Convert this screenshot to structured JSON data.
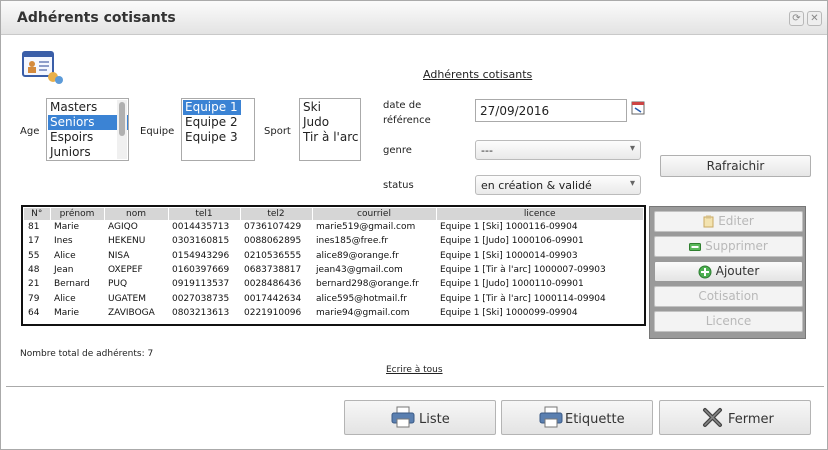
{
  "window": {
    "title": "Adhérents cotisants",
    "controls": [
      "⟳",
      "✕"
    ]
  },
  "page_link_title": "Adhérents cotisants",
  "filters": {
    "age": {
      "label": "Age",
      "options": [
        "Masters",
        "Seniors",
        "Espoirs",
        "Juniors"
      ],
      "selected": "Seniors"
    },
    "equipe": {
      "label": "Equipe",
      "options": [
        "Equipe 1",
        "Equipe 2",
        "Equipe 3"
      ],
      "selected": "Equipe 1"
    },
    "sport": {
      "label": "Sport",
      "options": [
        "Ski",
        "Judo",
        "Tir à l'arc"
      ],
      "selected": ""
    },
    "date_label_line1": "date de",
    "date_label_line2": "référence",
    "date_value": "27/09/2016",
    "genre": {
      "label": "genre",
      "value": "---"
    },
    "status": {
      "label": "status",
      "value": "en création & validé"
    },
    "refresh_label": "Rafraichir"
  },
  "table": {
    "headers": [
      "N°",
      "prénom",
      "nom",
      "tel1",
      "tel2",
      "courriel",
      "licence"
    ],
    "rows": [
      [
        "81",
        "Marie",
        "AGIQO",
        "0014435713",
        "0736107429",
        "marie519@gmail.com",
        "Equipe 1 [Ski] 1000116-09904"
      ],
      [
        "17",
        "Ines",
        "HEKENU",
        "0303160815",
        "0088062895",
        "ines185@free.fr",
        "Equipe 1 [Judo] 1000106-09901"
      ],
      [
        "55",
        "Alice",
        "NISA",
        "0154943296",
        "0210536555",
        "alice89@orange.fr",
        "Equipe 1 [Ski] 1000014-09903"
      ],
      [
        "48",
        "Jean",
        "OXEPEF",
        "0160397669",
        "0683738817",
        "jean43@gmail.com",
        "Equipe 1 [Tir à l'arc] 1000007-09903"
      ],
      [
        "21",
        "Bernard",
        "PUQ",
        "0919113537",
        "0028486436",
        "bernard298@orange.fr",
        "Equipe 1 [Judo] 1000110-09901"
      ],
      [
        "79",
        "Alice",
        "UGATEM",
        "0027038735",
        "0017442634",
        "alice595@hotmail.fr",
        "Equipe 1 [Tir à l'arc] 1000114-09904"
      ],
      [
        "64",
        "Marie",
        "ZAVIBOGA",
        "0803213613",
        "0221910096",
        "marie94@gmail.com",
        "Equipe 1 [Ski] 1000099-09904"
      ]
    ]
  },
  "actions": {
    "edit": "Editer",
    "delete": "Supprimer",
    "add": "Ajouter",
    "cotisation": "Cotisation",
    "licence": "Licence"
  },
  "total_text": "Nombre total de adhérents: 7",
  "write_all_link": "Ecrire à tous",
  "footer": {
    "list": "Liste",
    "label": "Etiquette",
    "close": "Fermer"
  },
  "colors": {
    "selection": "#3b83d4",
    "header_bg": "#d6d6d6",
    "side_panel": "#9a9a9a"
  }
}
